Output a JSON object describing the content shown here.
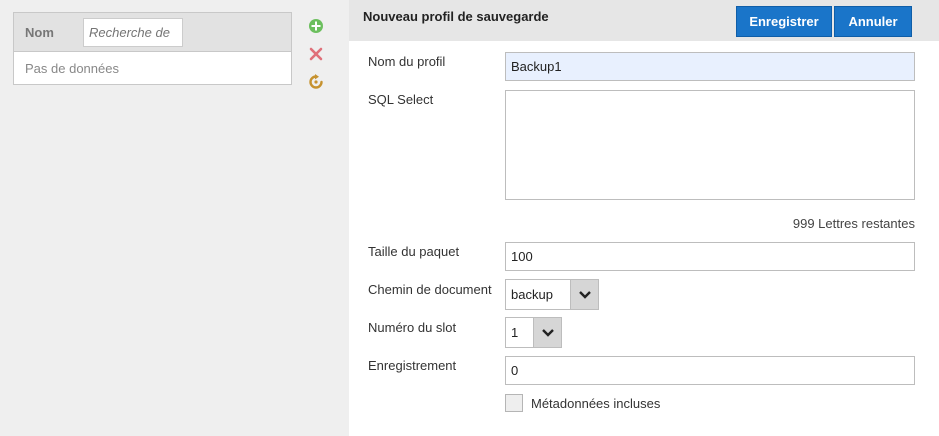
{
  "list": {
    "column_name": "Nom",
    "search_placeholder": "Recherche de",
    "empty_text": "Pas de données"
  },
  "tools": {
    "add_icon": "plus-circle-icon",
    "delete_icon": "close-icon",
    "refresh_icon": "refresh-icon",
    "colors": {
      "add": "#6cbf5e",
      "delete": "#e0707a",
      "refresh": "#c6922f"
    }
  },
  "form": {
    "title": "Nouveau profil de sauvegarde",
    "save_label": "Enregistrer",
    "cancel_label": "Annuler",
    "profile_name_label": "Nom du profil",
    "profile_name_value": "Backup1",
    "sql_select_label": "SQL Select",
    "sql_select_value": "",
    "remaining_text": "999 Lettres restantes",
    "packet_size_label": "Taille du paquet",
    "packet_size_value": "100",
    "doc_path_label": "Chemin de document",
    "doc_path_value": "backup",
    "slot_label": "Numéro du slot",
    "slot_value": "1",
    "record_label": "Enregistrement",
    "record_value": "0",
    "metadata_label": "Métadonnées incluses",
    "metadata_checked": false
  },
  "colors": {
    "accent": "#1a75c9"
  }
}
